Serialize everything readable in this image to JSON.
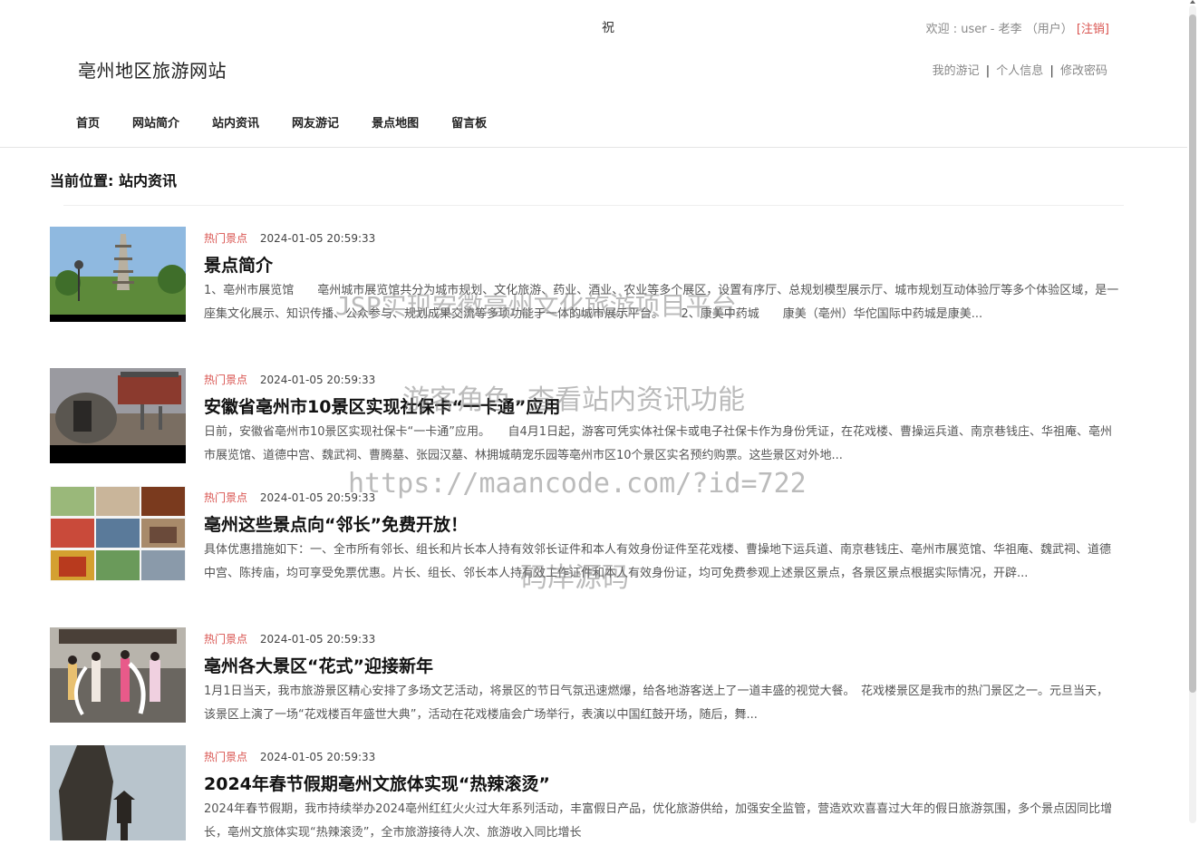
{
  "header": {
    "marquee": "祝",
    "site_title": "亳州地区旅游网站",
    "welcome": "欢迎 : user - 老李 （用户）",
    "logout": "[注销]",
    "user_links": [
      "我的游记",
      "个人信息",
      "修改密码"
    ],
    "separator": "|"
  },
  "nav": [
    "首页",
    "网站简介",
    "站内资讯",
    "网友游记",
    "景点地图",
    "留言板"
  ],
  "breadcrumb": "当前位置: 站内资讯",
  "news": [
    {
      "category": "热门景点",
      "date": "2024-01-05 20:59:33",
      "title": "景点简介",
      "summary": "1、亳州市展览馆　　亳州城市展览馆共分为城市规划、文化旅游、药业、酒业、农业等多个展区，设置有序厅、总规划模型展示厅、城市规划互动体验厅等多个体验区域，是一座集文化展示、知识传播、公众参与、规划成果交流等多项功能于一体的城市展示平台。　　2、康美中药城　　康美（亳州）华佗国际中药城是康美...",
      "image_icon": "pagoda-photo"
    },
    {
      "category": "热门景点",
      "date": "2024-01-05 20:59:33",
      "title": "安徽省亳州市10景区实现社保卡“一卡通”应用",
      "summary": "日前，安徽省亳州市10景区实现社保卡“一卡通”应用。　　自4月1日起，游客可凭实体社保卡或电子社保卡作为身份凭证，在花戏楼、曹操运兵道、南京巷钱庄、华祖庵、亳州市展览馆、道德中宫、魏武祠、曹腾墓、张园汉墓、林拥城萌宠乐园等亳州市区10个景区实名预约购票。这些景区对外地...",
      "image_icon": "stone-monument-photo"
    },
    {
      "category": "热门景点",
      "date": "2024-01-05 20:59:33",
      "title": "亳州这些景点向“邻长”免费开放！",
      "summary": "具体优惠措施如下：一、全市所有邻长、组长和片长本人持有效邻长证件和本人有效身份证件至花戏楼、曹操地下运兵道、南京巷钱庄、亳州市展览馆、华祖庵、魏武祠、道德中宫、陈抟庙，均可享受免票优惠。片长、组长、邻长本人持有效工作证件和本人有效身份证，均可免费参观上述景区景点，各景区景点根据实际情况，开辟...",
      "image_icon": "attractions-collage-photo"
    },
    {
      "category": "热门景点",
      "date": "2024-01-05 20:59:33",
      "title": "亳州各大景区“花式”迎接新年",
      "summary": "1月1日当天，我市旅游景区精心安排了多场文艺活动，将景区的节日气氛迅速燃爆，给各地游客送上了一道丰盛的视觉大餐。　花戏楼景区是我市的热门景区之一。元旦当天，该景区上演了一场“花戏楼百年盛世大典”，活动在花戏楼庙会广场举行，表演以中国红鼓开场，随后，舞...",
      "image_icon": "dancers-photo"
    },
    {
      "category": "热门景点",
      "date": "2024-01-05 20:59:33",
      "title": "2024年春节假期亳州文旅体实现“热辣滚烫”",
      "summary": "2024年春节假期，我市持续举办2024亳州红红火火过大年系列活动，丰富假日产品，优化旅游供给，加强安全监管，营造欢欢喜喜过大年的假日旅游氛围，多个景点因同比增长，亳州文旅体实现“热辣滚烫”，全市旅游接待人次、旅游收入同比增长",
      "image_icon": "statue-photo"
    }
  ],
  "watermarks": [
    "JSP实现安徽亳州文化旅游项目平台",
    "游客角色-查看站内资讯功能",
    "https://maancode.com/?id=722",
    "码岸源码"
  ]
}
